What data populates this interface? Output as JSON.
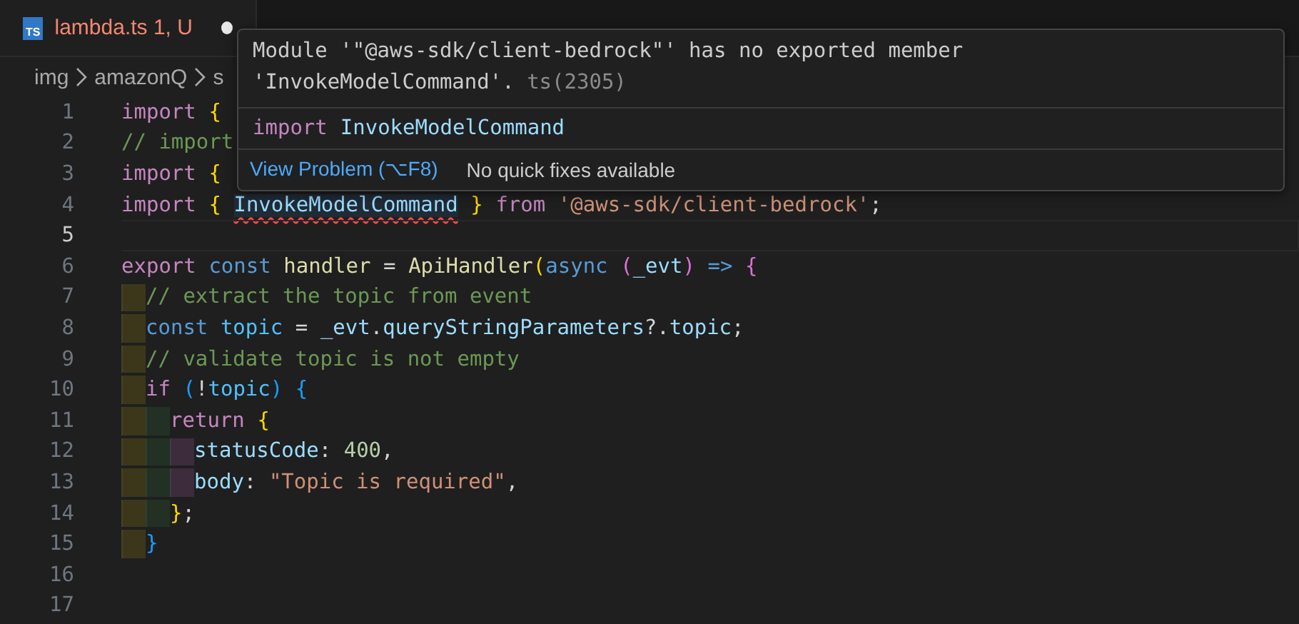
{
  "tab": {
    "icon": "TS",
    "filename": "lambda.ts",
    "status": "1, U",
    "modified": true
  },
  "breadcrumb": [
    "img",
    "amazonQ",
    "s"
  ],
  "lines": [
    {
      "number": "1",
      "current": false,
      "words": [
        [
          {
            "kind": "keyword",
            "text": "import"
          }
        ],
        [
          {
            "kind": "brace",
            "text": "{"
          }
        ]
      ]
    },
    {
      "number": "2",
      "current": false,
      "words": [
        [
          {
            "kind": "comment",
            "text": "// import"
          }
        ]
      ]
    },
    {
      "number": "3",
      "current": false,
      "words": [
        [
          {
            "kind": "keyword",
            "text": "import"
          }
        ],
        [
          {
            "kind": "brace",
            "text": "{"
          }
        ]
      ]
    },
    {
      "number": "4",
      "current": false,
      "words": [
        [
          {
            "kind": "keyword",
            "text": "import"
          }
        ],
        [
          {
            "kind": "brace",
            "text": "{"
          }
        ],
        [
          {
            "kind": "error",
            "text": "InvokeModelCommand"
          }
        ],
        [
          {
            "kind": "brace",
            "text": "}"
          }
        ],
        [
          {
            "kind": "keyword",
            "text": "from"
          }
        ],
        [
          {
            "kind": "string",
            "text": "'@aws-sdk/client-bedrock'"
          },
          {
            "kind": "plain",
            "text": ";"
          }
        ]
      ]
    },
    {
      "number": "5",
      "current": true
    },
    {
      "number": "6",
      "current": false,
      "words": [
        [
          {
            "kind": "keyword",
            "text": "export"
          }
        ],
        [
          {
            "kind": "storage",
            "text": "const"
          }
        ],
        [
          {
            "kind": "function",
            "text": "handler"
          }
        ],
        [
          {
            "kind": "plain",
            "text": "="
          }
        ],
        [
          {
            "kind": "function",
            "text": "ApiHandler"
          },
          {
            "kind": "brace",
            "text": "("
          },
          {
            "kind": "storage",
            "text": "async"
          }
        ],
        [
          {
            "kind": "paren",
            "text": "("
          },
          {
            "kind": "variable",
            "text": "_evt"
          },
          {
            "kind": "paren",
            "text": ")"
          }
        ],
        [
          {
            "kind": "storage",
            "text": "=>"
          }
        ],
        [
          {
            "kind": "paren",
            "text": "{"
          }
        ]
      ],
      "children": [
        {
          "number": "7",
          "current": false,
          "words": [
            [
              {
                "kind": "comment",
                "text": "// extract the topic from event"
              }
            ]
          ]
        },
        {
          "number": "8",
          "current": false,
          "words": [
            [
              {
                "kind": "storage",
                "text": "const"
              }
            ],
            [
              {
                "kind": "constant",
                "text": "topic"
              }
            ],
            [
              {
                "kind": "plain",
                "text": "="
              }
            ],
            [
              {
                "kind": "variable",
                "text": "_evt"
              },
              {
                "kind": "plain",
                "text": "."
              },
              {
                "kind": "variable",
                "text": "queryStringParameters"
              },
              {
                "kind": "plain",
                "text": "?."
              },
              {
                "kind": "variable",
                "text": "topic"
              },
              {
                "kind": "plain",
                "text": ";"
              }
            ]
          ]
        },
        {
          "number": "9",
          "current": false,
          "words": [
            [
              {
                "kind": "comment",
                "text": "// validate topic is not empty"
              }
            ]
          ]
        },
        {
          "number": "10",
          "current": false,
          "words": [
            [
              {
                "kind": "keyword",
                "text": "if"
              }
            ],
            [
              {
                "kind": "bracket",
                "text": "("
              },
              {
                "kind": "plain",
                "text": "!"
              },
              {
                "kind": "constant",
                "text": "topic"
              },
              {
                "kind": "bracket",
                "text": ")"
              }
            ],
            [
              {
                "kind": "bracket",
                "text": "{"
              }
            ]
          ],
          "children": [
            {
              "number": "11",
              "current": false,
              "words": [
                [
                  {
                    "kind": "keyword",
                    "text": "return"
                  }
                ],
                [
                  {
                    "kind": "brace",
                    "text": "{"
                  }
                ]
              ],
              "children": [
                {
                  "number": "12",
                  "current": false,
                  "words": [
                    [
                      {
                        "kind": "variable",
                        "text": "statusCode"
                      },
                      {
                        "kind": "plain",
                        "text": ":"
                      }
                    ],
                    [
                      {
                        "kind": "number",
                        "text": "400"
                      },
                      {
                        "kind": "plain",
                        "text": ","
                      }
                    ]
                  ]
                },
                {
                  "number": "13",
                  "current": false,
                  "words": [
                    [
                      {
                        "kind": "variable",
                        "text": "body"
                      },
                      {
                        "kind": "plain",
                        "text": ":"
                      }
                    ],
                    [
                      {
                        "kind": "string",
                        "text": "\"Topic is required\""
                      },
                      {
                        "kind": "plain",
                        "text": ","
                      }
                    ]
                  ]
                }
              ]
            },
            {
              "number": "14",
              "current": false,
              "words": [
                [
                  {
                    "kind": "brace",
                    "text": "}"
                  },
                  {
                    "kind": "plain",
                    "text": ";"
                  }
                ]
              ]
            }
          ]
        },
        {
          "number": "15",
          "current": false,
          "words": [
            [
              {
                "kind": "bracket",
                "text": "}"
              }
            ]
          ]
        }
      ]
    },
    {
      "number": "16",
      "current": false
    },
    {
      "number": "17",
      "current": false
    }
  ],
  "hover": {
    "message": [
      "Module '\"@aws-sdk/client-bedrock\"' has no exported member",
      "'InvokeModelCommand'."
    ],
    "code": "ts(2305)",
    "suggestion": [
      {
        "kind": "keyword",
        "text": "import"
      },
      {
        "kind": "variable",
        "text": "InvokeModelCommand"
      }
    ],
    "action": "View Problem (⌥F8)",
    "note": "No quick fixes available"
  }
}
